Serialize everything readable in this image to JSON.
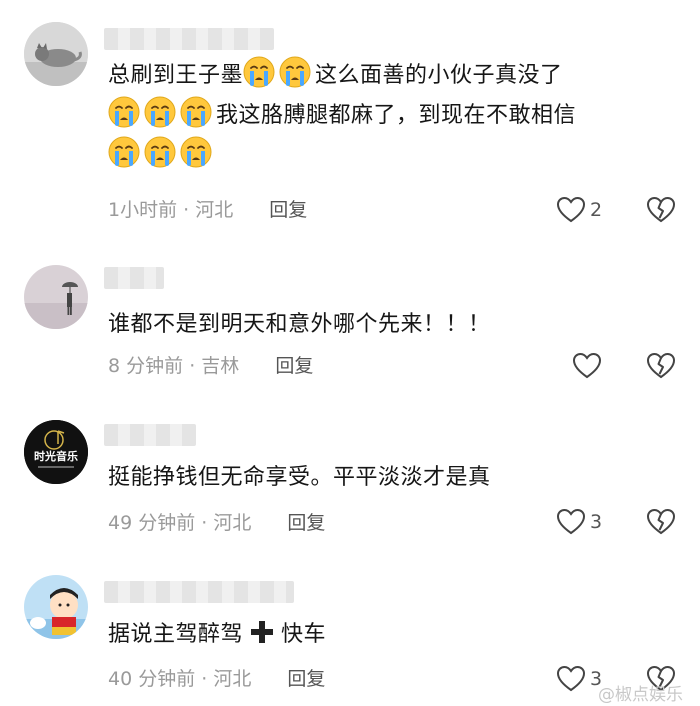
{
  "comments": [
    {
      "text_1": "总刷到王子墨",
      "text_2": "这么面善的小伙子真没了",
      "text_3": "我这胳膊腿都麻了，到现在不敢相信",
      "time": "1小时前",
      "location": "河北",
      "reply": "回复",
      "likes": "2",
      "emoji": "crying-face-icon"
    },
    {
      "text": "谁都不是到明天和意外哪个先来！！！",
      "time": "8 分钟前",
      "location": "吉林",
      "reply": "回复",
      "likes": ""
    },
    {
      "text": "挺能挣钱但无命享受。平平淡淡才是真",
      "avatar_text": "时光音乐",
      "time": "49 分钟前",
      "location": "河北",
      "reply": "回复",
      "likes": "3"
    },
    {
      "text_1": "据说主驾醉驾",
      "text_2": "快车",
      "time": "40 分钟前",
      "location": "河北",
      "reply": "回复",
      "likes": "3"
    }
  ],
  "separator": "·",
  "watermark": "@椒点娱乐",
  "colors": {
    "meta_gray": "#9a9a9a",
    "text": "#161616",
    "emoji_yellow": "#ffc83d",
    "tear_blue": "#4aa8ff"
  }
}
